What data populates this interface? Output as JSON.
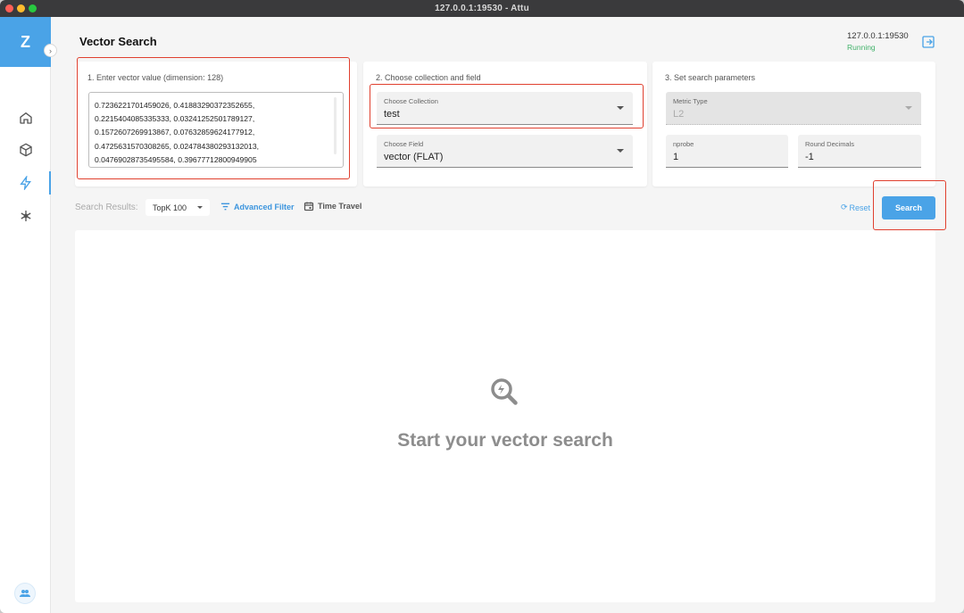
{
  "window": {
    "title": "127.0.0.1:19530 - Attu"
  },
  "sidebar": {
    "logo_text": "Z",
    "items": [
      {
        "name": "home",
        "icon": "home-icon"
      },
      {
        "name": "collections",
        "icon": "cube-icon"
      },
      {
        "name": "vector-search",
        "icon": "lightning-icon",
        "active": true
      },
      {
        "name": "system",
        "icon": "asterisk-icon"
      }
    ],
    "bottom_icon": "users-icon"
  },
  "header": {
    "title": "Vector Search",
    "server_address": "127.0.0.1:19530",
    "server_status": "Running",
    "status_color": "#43b26b"
  },
  "step1": {
    "title": "1. Enter vector value (dimension: 128)",
    "vector_text": "0.7236221701459026, 0.41883290372352655,\n0.2215404085335333, 0.03241252501789127,\n0.1572607269913867, 0.07632859624177912,\n0.4725631570308265, 0.024784380293132013,\n0.04769028735495584, 0.39677712800949905"
  },
  "step2": {
    "title": "2. Choose collection and field",
    "collection": {
      "label": "Choose Collection",
      "value": "test"
    },
    "field": {
      "label": "Choose Field",
      "value": "vector (FLAT)"
    }
  },
  "step3": {
    "title": "3. Set search parameters",
    "metric": {
      "label": "Metric Type",
      "value": "L2"
    },
    "nprobe": {
      "label": "nprobe",
      "value": "1"
    },
    "round": {
      "label": "Round Decimals",
      "value": "-1"
    }
  },
  "results": {
    "label": "Search Results:",
    "topk": "TopK 100",
    "advanced_filter": "Advanced Filter",
    "time_travel": "Time Travel",
    "reset": "Reset",
    "search": "Search",
    "empty_message": "Start your vector search"
  },
  "colors": {
    "accent": "#4aa3e7",
    "highlight": "#e0402f"
  }
}
